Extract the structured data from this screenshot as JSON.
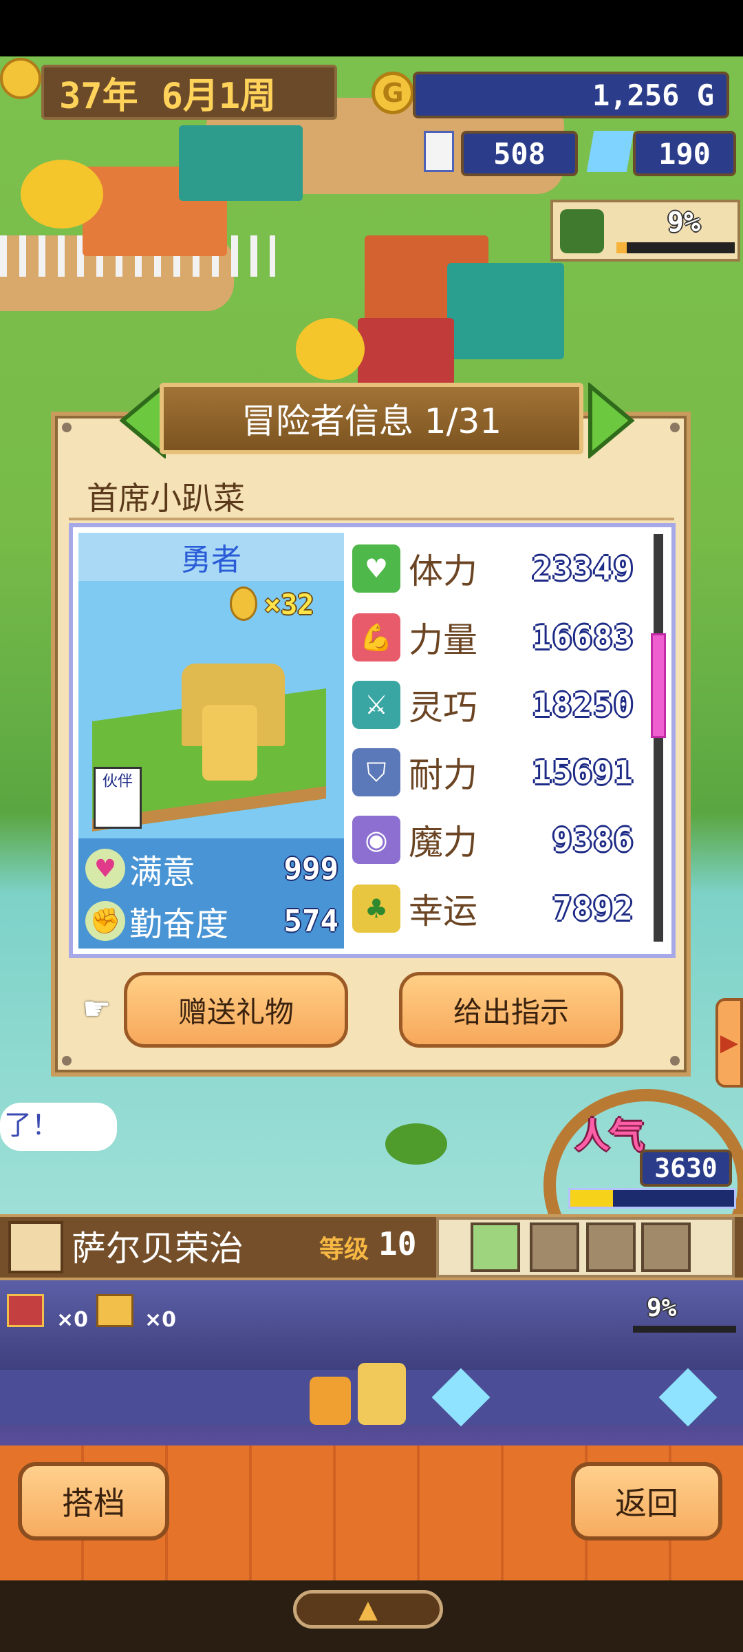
{
  "hud": {
    "year": "37年",
    "month_week": "6月1周",
    "gold": "1,256 G",
    "population": "508",
    "crystals": "190",
    "progress_percent": "9%",
    "popularity_label": "人气",
    "popularity_value": "3630"
  },
  "dialog": {
    "title": "冒险者信息 1/31",
    "adventurer_name": "首席小趴菜",
    "job": "勇者",
    "medal_count": "×32",
    "partner_label": "伙伴",
    "mood": [
      {
        "label": "满意",
        "value": "999",
        "icon": "heart-icon"
      },
      {
        "label": "勤奋度",
        "value": "574",
        "icon": "fist-icon"
      }
    ],
    "stats": [
      {
        "label": "体力",
        "value": "23349",
        "icon": "heart-icon",
        "color": "#4fb84a"
      },
      {
        "label": "力量",
        "value": "16683",
        "icon": "strength-icon",
        "color": "#e75b6a"
      },
      {
        "label": "灵巧",
        "value": "18250",
        "icon": "swords-icon",
        "color": "#3aa6a3"
      },
      {
        "label": "耐力",
        "value": "15691",
        "icon": "shield-icon",
        "color": "#5b78b8"
      },
      {
        "label": "魔力",
        "value": "9386",
        "icon": "magic-orb-icon",
        "color": "#8c6fd0"
      },
      {
        "label": "幸运",
        "value": "7892",
        "icon": "clover-icon",
        "color": "#e8c640"
      }
    ],
    "buttons": {
      "gift": "赠送礼物",
      "instruct": "给出指示"
    }
  },
  "world": {
    "speech_text": "了！"
  },
  "hero_bar": {
    "name": "萨尔贝荣治",
    "level_label": "等级",
    "level_value": "10"
  },
  "dungeon": {
    "chest_count_1": "×0",
    "chest_count_2": "×0",
    "progress": "9%"
  },
  "bottom": {
    "partner_button": "搭档",
    "back_button": "返回"
  }
}
